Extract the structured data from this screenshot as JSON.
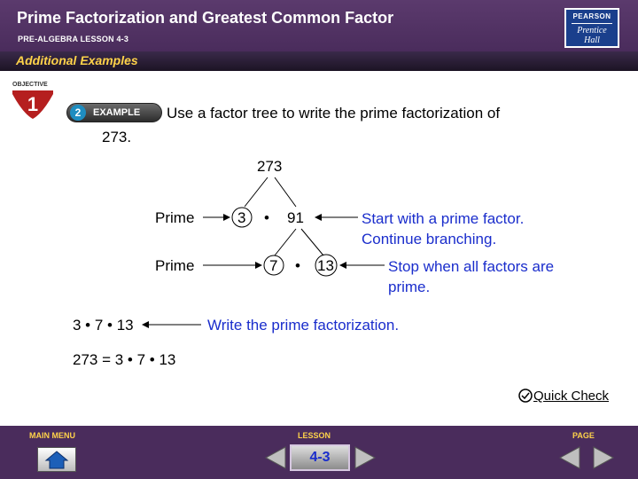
{
  "header": {
    "title": "Prime Factorization and Greatest Common Factor",
    "subtitle": "PRE-ALGEBRA LESSON 4-3",
    "logo_top": "PEARSON",
    "logo_bottom_1": "Prentice",
    "logo_bottom_2": "Hall"
  },
  "section_label": "Additional Examples",
  "objective": {
    "label": "OBJECTIVE",
    "number": "1"
  },
  "example": {
    "number": "2",
    "label": "EXAMPLE"
  },
  "problem": {
    "line1": "Use a factor tree to write the prime factorization of",
    "line2": "273."
  },
  "tree": {
    "root": "273",
    "row1": {
      "label": "Prime",
      "left": "3",
      "dot": "•",
      "right": "91",
      "note1": "Start with a prime factor.",
      "note2": "Continue branching."
    },
    "row2": {
      "label": "Prime",
      "left": "7",
      "dot": "•",
      "right": "13",
      "note1": "Stop when all factors are",
      "note2": "prime."
    }
  },
  "result": {
    "product": "3 • 7 • 13",
    "note": "Write the prime factorization.",
    "final": "273 = 3 • 7 • 13"
  },
  "quick_check": "Quick Check",
  "footer": {
    "main_menu": "MAIN MENU",
    "lesson": "LESSON",
    "page": "PAGE",
    "lesson_number": "4-3"
  },
  "colors": {
    "header": "#4a2c5c",
    "accent_yellow": "#ffd34a",
    "note_blue": "#1a2dcc"
  }
}
